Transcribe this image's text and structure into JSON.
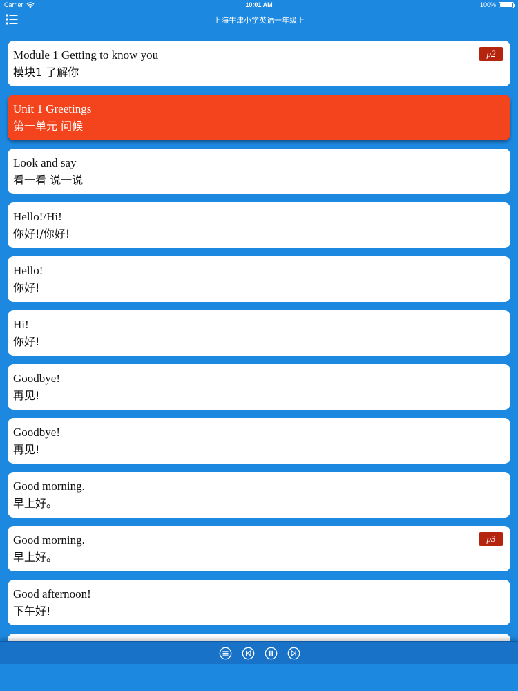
{
  "status_bar": {
    "carrier": "Carrier",
    "time": "10:01 AM",
    "battery": "100%"
  },
  "nav": {
    "title": "上海牛津小学英语一年级上",
    "menu_icon": "list-menu-icon"
  },
  "lessons": [
    {
      "en": "Module 1 Getting to know you",
      "zh": "模块1 了解你",
      "page": "p2",
      "active": false
    },
    {
      "en": "Unit 1 Greetings",
      "zh": "第一单元 问候",
      "page": "",
      "active": true
    },
    {
      "en": "Look and say",
      "zh": "看一看 说一说",
      "page": "",
      "active": false
    },
    {
      "en": "Hello!/Hi!",
      "zh": "你好!/你好!",
      "page": "",
      "active": false
    },
    {
      "en": "Hello!",
      "zh": "你好!",
      "page": "",
      "active": false
    },
    {
      "en": "Hi!",
      "zh": "你好!",
      "page": "",
      "active": false
    },
    {
      "en": "Goodbye!",
      "zh": "再见!",
      "page": "",
      "active": false
    },
    {
      "en": "Goodbye!",
      "zh": "再见!",
      "page": "",
      "active": false
    },
    {
      "en": "Good morning.",
      "zh": "早上好。",
      "page": "",
      "active": false
    },
    {
      "en": "Good morning.",
      "zh": "早上好。",
      "page": "p3",
      "active": false
    },
    {
      "en": "Good afternoon!",
      "zh": "下午好!",
      "page": "",
      "active": false
    }
  ],
  "toolbar": {
    "buttons": [
      "playlist-icon",
      "previous-icon",
      "pause-icon",
      "next-icon"
    ]
  },
  "colors": {
    "background": "#1d88e0",
    "active_card": "#f4441e",
    "page_badge": "#b5250d",
    "toolbar": "#1872c8"
  }
}
